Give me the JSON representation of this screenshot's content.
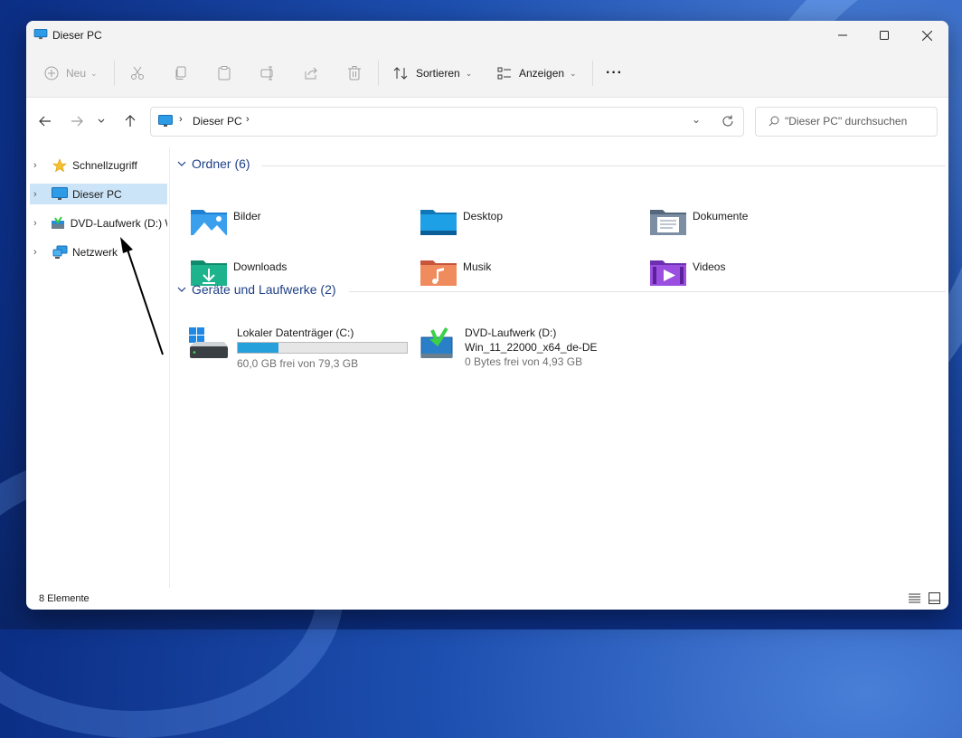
{
  "window": {
    "title": "Dieser PC"
  },
  "toolbar": {
    "new_label": "Neu",
    "sort_label": "Sortieren",
    "view_label": "Anzeigen",
    "more_label": "···"
  },
  "address": {
    "path": [
      "Dieser PC"
    ],
    "search_placeholder": "\"Dieser PC\" durchsuchen"
  },
  "sidebar": {
    "items": [
      {
        "label": "Schnellzugriff",
        "icon": "star-icon"
      },
      {
        "label": "Dieser PC",
        "icon": "computer-icon",
        "selected": true
      },
      {
        "label": "DVD-Laufwerk (D:) W",
        "icon": "dvd-drive-icon"
      },
      {
        "label": "Netzwerk",
        "icon": "network-icon"
      }
    ]
  },
  "groups": {
    "folders": {
      "title": "Ordner (6)",
      "items": [
        {
          "label": "Bilder",
          "icon": "pictures-folder-icon"
        },
        {
          "label": "Desktop",
          "icon": "desktop-folder-icon"
        },
        {
          "label": "Dokumente",
          "icon": "documents-folder-icon"
        },
        {
          "label": "Downloads",
          "icon": "downloads-folder-icon"
        },
        {
          "label": "Musik",
          "icon": "music-folder-icon"
        },
        {
          "label": "Videos",
          "icon": "videos-folder-icon"
        }
      ]
    },
    "devices": {
      "title": "Geräte und Laufwerke (2)",
      "items": [
        {
          "name": "Lokaler Datenträger (C:)",
          "free": "60,0 GB frei von 79,3 GB",
          "used_fraction": 0.243,
          "icon": "local-disk-icon"
        },
        {
          "name": "DVD-Laufwerk (D:)",
          "volume": "Win_11_22000_x64_de-DE",
          "free": "0 Bytes frei von 4,93 GB",
          "icon": "dvd-drive-icon"
        }
      ]
    }
  },
  "status": {
    "count": "8 Elemente"
  },
  "colors": {
    "accent": "#26a0da",
    "selection": "#cce4f7",
    "group_title": "#1e3f87"
  }
}
